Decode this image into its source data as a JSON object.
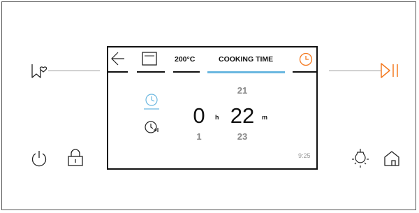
{
  "header": {
    "temperature": "200°C",
    "tab_label": "COOKING TIME"
  },
  "time_wheel": {
    "hours": {
      "above": "",
      "current": "0",
      "below": "1",
      "unit": "h"
    },
    "minutes": {
      "above": "21",
      "current": "22",
      "below": "23",
      "unit": "m"
    }
  },
  "status": {
    "clock": "9:25"
  },
  "colors": {
    "accent_blue": "#6ab7e0",
    "accent_orange": "#f47a20",
    "line_gray": "#9a9a9a"
  },
  "icons": {
    "favorite": "bookmark-heart-icon",
    "play_pause": "play-pause-icon",
    "power": "power-icon",
    "lock": "lock-icon",
    "light": "oven-light-icon",
    "home": "home-icon",
    "back": "back-arrow-icon",
    "oven": "oven-function-icon",
    "timer": "timer-icon",
    "duration_mode": "duration-clock-icon",
    "end_time_mode": "end-time-clock-icon"
  }
}
